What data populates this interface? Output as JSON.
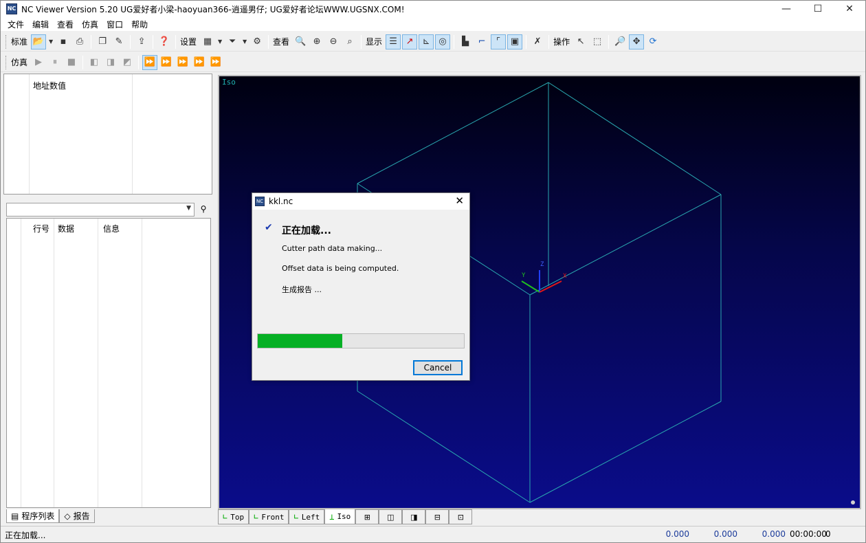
{
  "window": {
    "title": "NC Viewer  Version 5.20  UG爱好者小梁-haoyuan366-逍遥男仔; UG爱好者论坛WWW.UGSNX.COM!",
    "icon": "nc-app-icon",
    "controls": {
      "minimize": "—",
      "maximize": "☐",
      "close": "✕"
    }
  },
  "menu": [
    "文件",
    "编辑",
    "查看",
    "仿真",
    "窗口",
    "帮助"
  ],
  "toolbar1": {
    "standard_label": "标准",
    "settings_label": "设置",
    "view_label": "查看",
    "display_label": "显示",
    "operate_label": "操作"
  },
  "toolbar2": {
    "simulate_label": "仿真"
  },
  "address_panel": {
    "header": "地址数值"
  },
  "program_list": {
    "combo_value": "",
    "columns": [
      "行号",
      "数据",
      "信息"
    ]
  },
  "left_tabs": [
    "程序列表",
    "报告"
  ],
  "viewport": {
    "view_name": "Iso",
    "axes": {
      "x": "X",
      "y": "Y",
      "z": "Z"
    },
    "wire_color": "#2aa8b0"
  },
  "view_tabs": [
    "Top",
    "Front",
    "Left",
    "Iso"
  ],
  "status": {
    "text": "正在加载...",
    "x": "0.000",
    "y": "0.000",
    "z": "0.000",
    "time": "00:00:00",
    "count": "0"
  },
  "dialog": {
    "title": "kkl.nc",
    "heading": "正在加载...",
    "lines": [
      "Cutter path data making...",
      "Offset data is being computed.",
      "生成报告 ..."
    ],
    "progress": 0.41,
    "progress_color": "#06b025",
    "cancel_label": "Cancel"
  }
}
